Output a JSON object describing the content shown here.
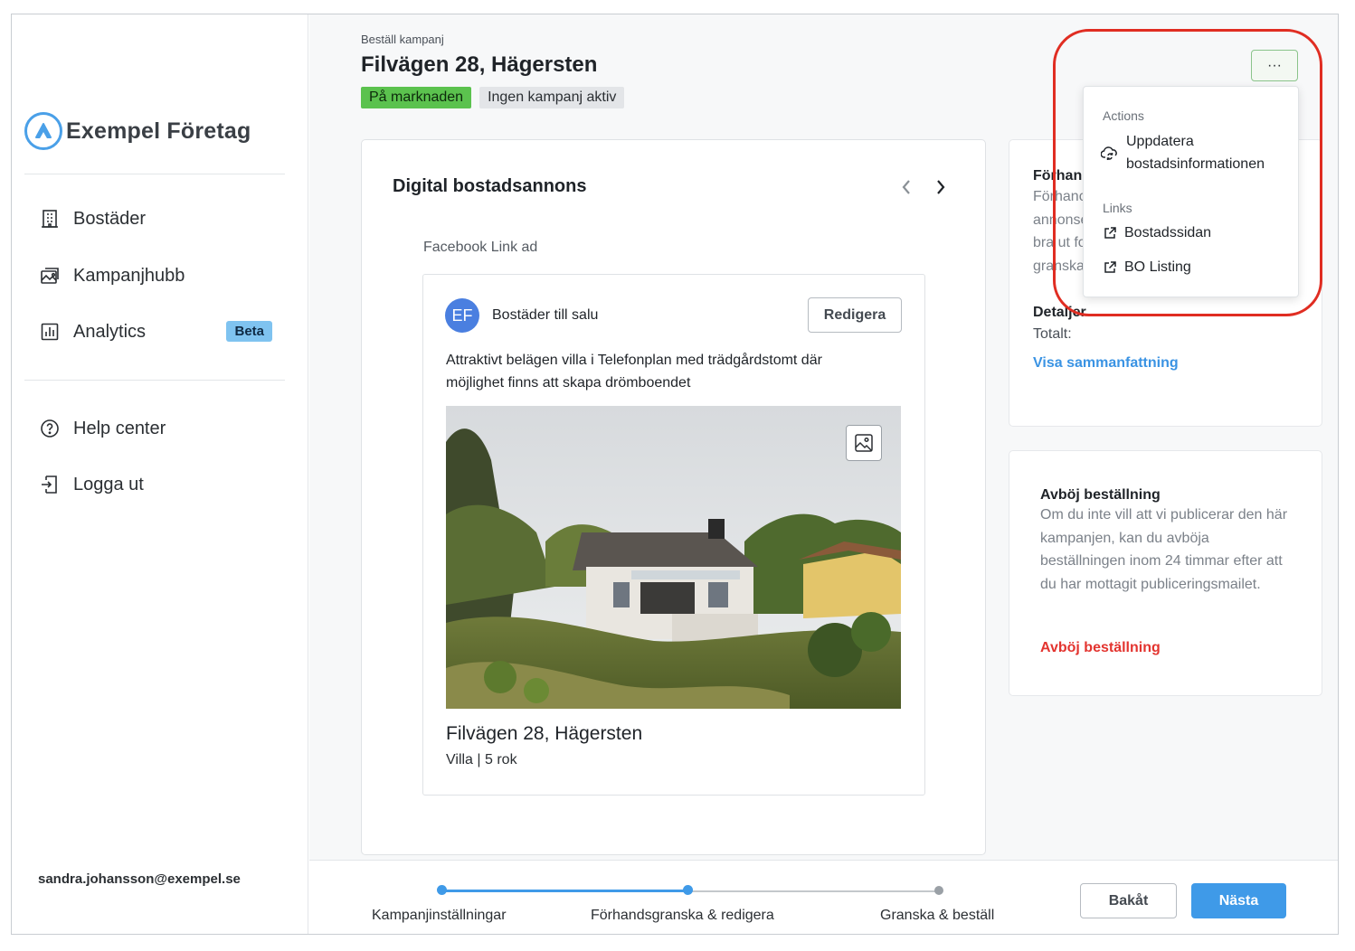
{
  "sidebar": {
    "company_name": "Exempel Företag",
    "nav": [
      {
        "label": "Bostäder",
        "icon": "building-icon"
      },
      {
        "label": "Kampanjhubb",
        "icon": "image-gallery-icon"
      },
      {
        "label": "Analytics",
        "icon": "bar-chart-icon",
        "badge": "Beta"
      }
    ],
    "secondary_nav": [
      {
        "label": "Help center",
        "icon": "question-circle-icon"
      },
      {
        "label": "Logga ut",
        "icon": "logout-icon"
      }
    ],
    "user_email": "sandra.johansson@exempel.se"
  },
  "header": {
    "breadcrumb": "Beställ kampanj",
    "title": "Filvägen 28, Hägersten",
    "tags": [
      "På marknaden",
      "Ingen kampanj aktiv"
    ],
    "more_button": "···"
  },
  "preview": {
    "title": "Digital bostadsannons",
    "ad_type": "Facebook Link ad",
    "avatar_initials": "EF",
    "page_name": "Bostäder till salu",
    "edit_label": "Redigera",
    "ad_text": "Attraktivt belägen villa i Telefonplan med trädgårdstomt där möjlighet finns att skapa drömboendet",
    "headline": "Filvägen 28, Hägersten",
    "subline": "Villa | 5 rok"
  },
  "side_card": {
    "title_partial": "Förhan",
    "text_lines": [
      "Förhanc",
      "annonse",
      "bra ut fo",
      "granska"
    ],
    "details_title": "Detaljer",
    "total_label": "Totalt:",
    "summary_link": "Visa sammanfattning"
  },
  "decline_card": {
    "title": "Avböj beställning",
    "text": "Om du inte vill att vi publicerar den här kampanjen, kan du avböja beställningen inom 24 timmar efter att du har mottagit publiceringsmailet.",
    "link": "Avböj beställning"
  },
  "dropdown": {
    "actions_title": "Actions",
    "update_label_line1": "Uppdatera",
    "update_label_line2": "bostadsinformationen",
    "links_title": "Links",
    "link1": "Bostadssidan",
    "link2": "BO Listing"
  },
  "footer": {
    "steps": [
      "Kampanjinställningar",
      "Förhandsgranska & redigera",
      "Granska & beställ"
    ],
    "current_step": 2,
    "back_label": "Bakåt",
    "next_label": "Nästa"
  },
  "colors": {
    "accent": "#3f9ae8",
    "tag_green": "#5bc24e",
    "danger": "#e3342f",
    "highlight": "#e02d22"
  }
}
